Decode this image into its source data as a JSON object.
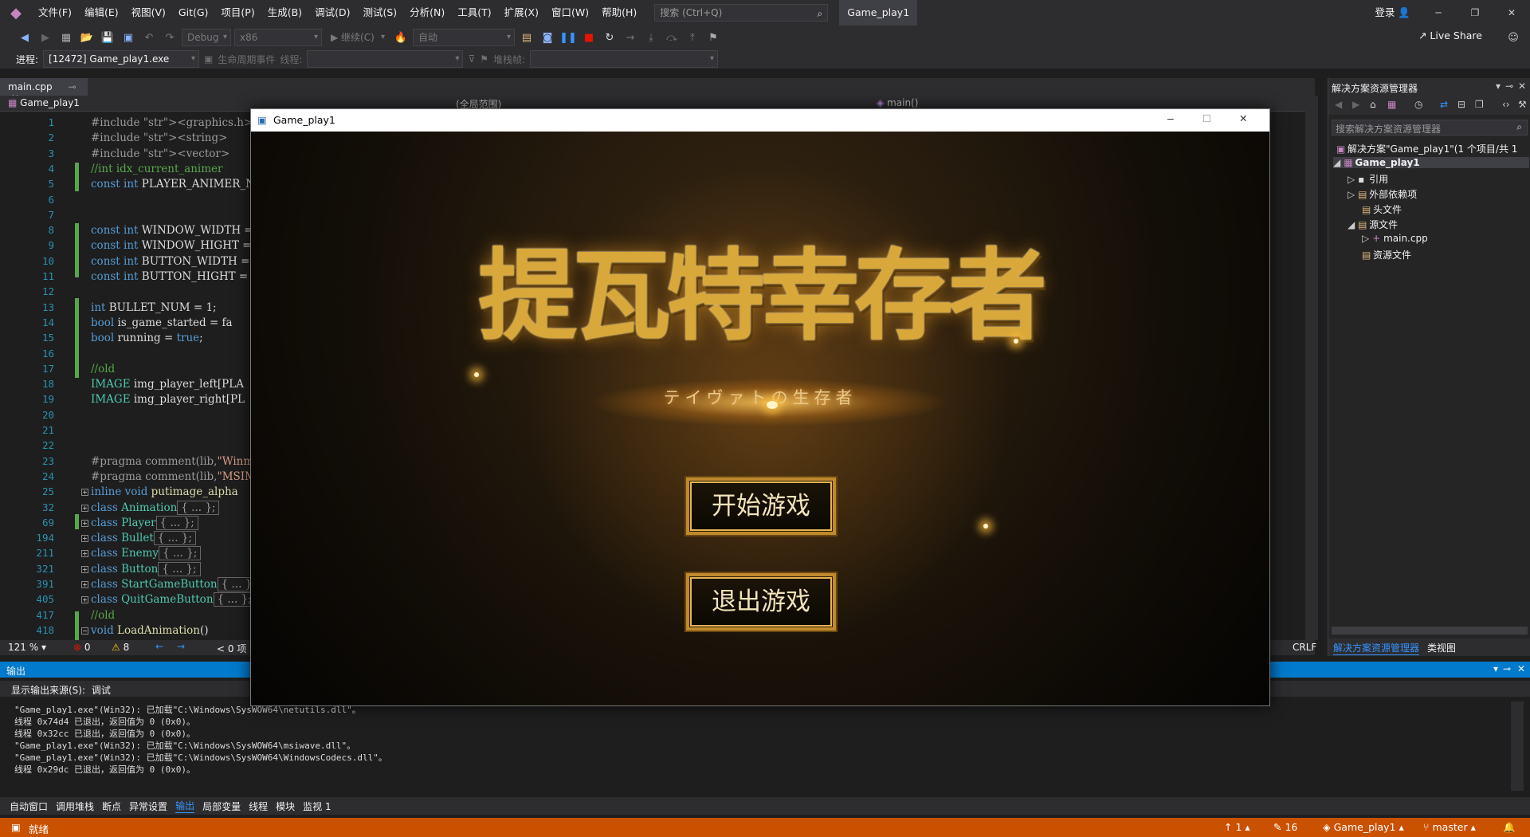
{
  "menubar": {
    "items": [
      "文件(F)",
      "编辑(E)",
      "视图(V)",
      "Git(G)",
      "项目(P)",
      "生成(B)",
      "调试(D)",
      "测试(S)",
      "分析(N)",
      "工具(T)",
      "扩展(X)",
      "窗口(W)",
      "帮助(H)"
    ],
    "search_placeholder": "搜索 (Ctrl+Q)",
    "solution_name": "Game_play1",
    "login": "登录"
  },
  "toolbar": {
    "config": "Debug",
    "platform": "x86",
    "continue": "继续(C)",
    "auto": "自动",
    "live_share": "Live Share"
  },
  "debug_bar": {
    "process_label": "进程:",
    "process_value": "[12472] Game_play1.exe",
    "lifecycle_label": "生命周期事件",
    "thread_label": "线程:",
    "stackframe_label": "堆栈帧:"
  },
  "editor": {
    "tab_name": "main.cpp",
    "nav_project": "Game_play1",
    "nav_scope": "(全局范围)",
    "nav_member": "main()",
    "zoom": "121 %",
    "errors": "0",
    "warnings": "8",
    "messages": "0 项",
    "line_ending": "CRLF",
    "lines": [
      {
        "n": "1",
        "text": "#include <graphics.h>"
      },
      {
        "n": "2",
        "text": "#include <string>"
      },
      {
        "n": "3",
        "text": "#include <vector>"
      },
      {
        "n": "4",
        "text": "//int idx_current_animer"
      },
      {
        "n": "5",
        "text": "const int PLAYER_ANIMER_N"
      },
      {
        "n": "6",
        "text": ""
      },
      {
        "n": "7",
        "text": ""
      },
      {
        "n": "8",
        "text": "const int WINDOW_WIDTH = "
      },
      {
        "n": "9",
        "text": "const int WINDOW_HIGHT = "
      },
      {
        "n": "10",
        "text": "const int BUTTON_WIDTH = "
      },
      {
        "n": "11",
        "text": "const int BUTTON_HIGHT = "
      },
      {
        "n": "12",
        "text": ""
      },
      {
        "n": "13",
        "text": "int BULLET_NUM = 1;"
      },
      {
        "n": "14",
        "text": "bool is_game_started = fa"
      },
      {
        "n": "15",
        "text": "bool running = true;"
      },
      {
        "n": "16",
        "text": ""
      },
      {
        "n": "17",
        "text": "//old"
      },
      {
        "n": "18",
        "text": "IMAGE img_player_left[PLA"
      },
      {
        "n": "19",
        "text": "IMAGE img_player_right[PL"
      },
      {
        "n": "20",
        "text": ""
      },
      {
        "n": "21",
        "text": ""
      },
      {
        "n": "22",
        "text": ""
      },
      {
        "n": "23",
        "text": "#pragma comment(lib,\"Winm"
      },
      {
        "n": "24",
        "text": "#pragma comment(lib,\"MSIM"
      },
      {
        "n": "25",
        "text": "inline void putimage_alpha"
      },
      {
        "n": "32",
        "text": "class Animation"
      },
      {
        "n": "69",
        "text": "class Player"
      },
      {
        "n": "194",
        "text": "class Bullet"
      },
      {
        "n": "211",
        "text": "class Enemy"
      },
      {
        "n": "321",
        "text": "class Button"
      },
      {
        "n": "391",
        "text": "class StartGameButton"
      },
      {
        "n": "405",
        "text": "class QuitGameButton"
      },
      {
        "n": "417",
        "text": "//old"
      },
      {
        "n": "418",
        "text": "void LoadAnimation()"
      }
    ],
    "collapsed_marker": "{ ... };"
  },
  "game_window": {
    "title": "Game_play1",
    "game_title": "提瓦特幸存者",
    "game_subtitle": "テイヴァトの生存者",
    "start_button": "开始游戏",
    "quit_button": "退出游戏"
  },
  "solution_explorer": {
    "header": "解决方案资源管理器",
    "search_placeholder": "搜索解决方案资源管理器",
    "solution_node": "解决方案\"Game_play1\"(1 个项目/共 1",
    "project_node": "Game_play1",
    "items": [
      "引用",
      "外部依赖项",
      "头文件",
      "源文件",
      "main.cpp",
      "资源文件"
    ],
    "tab_active": "解决方案资源管理器",
    "tab_other": "类视图"
  },
  "output": {
    "header": "输出",
    "source_label": "显示输出来源(S):",
    "source_value": "调试",
    "lines": [
      "\"Game_play1.exe\"(Win32): 已加载\"C:\\Windows\\SysWOW64\\netutils.dll\"。",
      "线程 0x74d4 已退出，返回值为 0 (0x0)。",
      "线程 0x32cc 已退出，返回值为 0 (0x0)。",
      "\"Game_play1.exe\"(Win32): 已加载\"C:\\Windows\\SysWOW64\\msiwave.dll\"。",
      "\"Game_play1.exe\"(Win32): 已加载\"C:\\Windows\\SysWOW64\\WindowsCodecs.dll\"。",
      "线程 0x29dc 已退出，返回值为 0 (0x0)。"
    ]
  },
  "bottom_tabs": [
    "自动窗口",
    "调用堆栈",
    "断点",
    "异常设置",
    "输出",
    "局部变量",
    "线程",
    "模块",
    "监视 1"
  ],
  "statusbar": {
    "ready": "就绪",
    "up_count": "1",
    "edit_count": "16",
    "repo": "Game_play1",
    "branch": "master"
  }
}
